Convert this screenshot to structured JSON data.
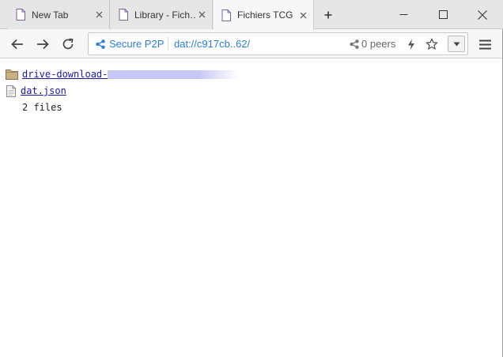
{
  "tabs": [
    {
      "title": "New Tab",
      "active": false
    },
    {
      "title": "Library - Fich…",
      "active": false
    },
    {
      "title": "Fichiers TCG",
      "active": true
    }
  ],
  "address_bar": {
    "security_label": "Secure P2P",
    "url_scheme": "dat://",
    "url_rest": "c917cb..62/",
    "peers": "0 peers"
  },
  "files": [
    {
      "name": "drive-download-",
      "type": "folder",
      "redacted_suffix": true
    },
    {
      "name": "dat.json",
      "type": "file",
      "redacted_suffix": false
    }
  ],
  "file_count": "2 files",
  "colors": {
    "accent": "#2a7de1",
    "link": "#1a1aa6",
    "folder": "#cbb083"
  }
}
